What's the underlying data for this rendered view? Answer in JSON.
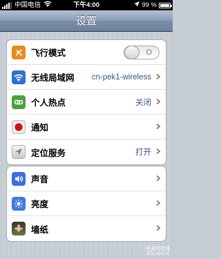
{
  "status_bar": {
    "carrier": "中国电信",
    "time": "下午4:00",
    "battery_percent": "99 %",
    "battery_level": 0.99,
    "signal_bars": 4
  },
  "nav": {
    "title": "设置"
  },
  "groups": [
    {
      "rows": [
        {
          "label": "飞行模式",
          "icon": "airplane-icon",
          "icon_color": "#e88a1a",
          "toggle_state": "O",
          "toggle_on": false
        },
        {
          "label": "无线局域网",
          "icon": "wifi-icon",
          "icon_color": "#2f6fd6",
          "value": "cn-pek1-wireless"
        },
        {
          "label": "个人热点",
          "icon": "chain-link-icon",
          "icon_color": "#4aa23c",
          "value": "关闭"
        },
        {
          "label": "通知",
          "icon": "notification-dot-icon",
          "icon_color": "#cc1010",
          "value": ""
        },
        {
          "label": "定位服务",
          "icon": "location-arrow-icon",
          "icon_color": "#8a8f96",
          "value": "打开"
        }
      ]
    },
    {
      "rows": [
        {
          "label": "声音",
          "icon": "speaker-icon",
          "icon_color": "#3b6ee0"
        },
        {
          "label": "亮度",
          "icon": "sun-icon",
          "icon_color": "#3c7be0"
        },
        {
          "label": "墙纸",
          "icon": "flower-icon",
          "icon_color": "#c04a7a"
        }
      ]
    }
  ],
  "watermark": {
    "line1": "中关村在线",
    "line2": "ZOL.com.cn"
  },
  "colors": {
    "value_text": "#385487",
    "page_bg": "#c5ccd4"
  }
}
